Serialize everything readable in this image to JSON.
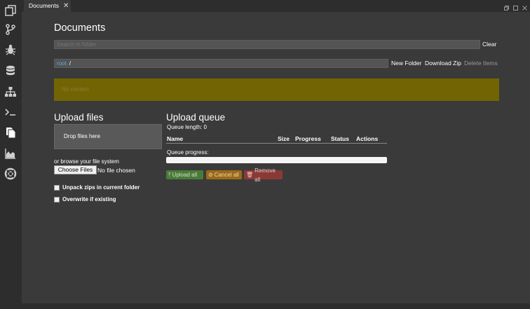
{
  "tab": {
    "label": "Documents",
    "close": "✕"
  },
  "sidebar": [
    "files-stack-icon",
    "branch-icon",
    "bug-icon",
    "database-icon",
    "sitemap-icon",
    "terminal-icon",
    "documents-icon",
    "area-chart-icon",
    "lifebuoy-icon"
  ],
  "page": {
    "title": "Documents"
  },
  "search": {
    "placeholder": "Search in folder",
    "clear_label": "Clear"
  },
  "path": {
    "root": "root",
    "separator": "/"
  },
  "actions": {
    "new_folder": "New Folder",
    "download_zip": "Download Zip",
    "delete_items": "Delete Items"
  },
  "status": {
    "no_content": "No content"
  },
  "upload": {
    "title": "Upload files",
    "dropzone": "Drop files here",
    "browse": "or browse your file system",
    "choose_files": "Choose Files",
    "no_file": "No file chosen",
    "unpack_label": "Unpack zips in current folder",
    "overwrite_label": "Overwrite if existing"
  },
  "queue": {
    "title": "Upload queue",
    "length_label": "Queue length: 0",
    "columns": {
      "name": "Name",
      "size": "Size",
      "progress": "Progress",
      "status": "Status",
      "actions": "Actions"
    },
    "progress_label": "Queue progress:",
    "progress_value": 0,
    "upload_all": "Upload all",
    "cancel_all": "Cancel all",
    "remove_all": "Remove all"
  },
  "colors": {
    "accent": "#5ba9e0",
    "warning": "#726403",
    "success": "#4a7a3a",
    "cancel": "#9a6a1a",
    "danger": "#8a3a36"
  }
}
